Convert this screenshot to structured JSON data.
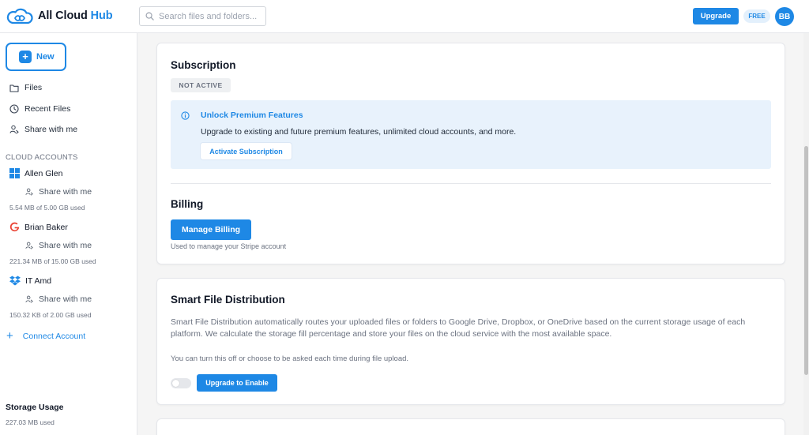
{
  "app": {
    "logo_text": "All Cloud",
    "logo_accent": "Hub",
    "brand_color": "#1e88e5"
  },
  "header": {
    "search_placeholder": "Search files and folders...",
    "upgrade_label": "Upgrade",
    "plan_badge": "FREE",
    "avatar_initials": "BB"
  },
  "sidebar": {
    "new_label": "New",
    "nav": [
      {
        "label": "Files",
        "icon": "folder-icon"
      },
      {
        "label": "Recent Files",
        "icon": "clock-icon"
      },
      {
        "label": "Share with me",
        "icon": "user-share-icon"
      }
    ],
    "cloud_accounts_label": "CLOUD ACCOUNTS",
    "accounts": [
      {
        "name": "Allen Glen",
        "provider_icon": "onedrive-windows-icon",
        "share_label": "Share with me",
        "used": "5.54 MB of 5.00 GB used"
      },
      {
        "name": "Brian Baker",
        "provider_icon": "google-icon",
        "share_label": "Share with me",
        "used": "221.34 MB of 15.00 GB used"
      },
      {
        "name": "IT Amd",
        "provider_icon": "dropbox-icon",
        "share_label": "Share with me",
        "used": "150.32 KB of 2.00 GB used"
      }
    ],
    "connect_label": "Connect Account",
    "storage_title": "Storage Usage",
    "storage_used": "227.03 MB used"
  },
  "subscription": {
    "title": "Subscription",
    "status": "NOT ACTIVE",
    "premium_title": "Unlock Premium Features",
    "premium_desc": "Upgrade to existing and future premium features, unlimited cloud accounts, and more.",
    "activate_label": "Activate Subscription",
    "billing_title": "Billing",
    "manage_billing_label": "Manage Billing",
    "billing_note": "Used to manage your Stripe account"
  },
  "smart_distribution": {
    "title": "Smart File Distribution",
    "description": "Smart File Distribution automatically routes your uploaded files or folders to Google Drive, Dropbox, or OneDrive based on the current storage usage of each platform. We calculate the storage fill percentage and store your files on the cloud service with the most available space.",
    "note": "You can turn this off or choose to be asked each time during file upload.",
    "toggle_on": false,
    "enable_label": "Upgrade to Enable"
  }
}
